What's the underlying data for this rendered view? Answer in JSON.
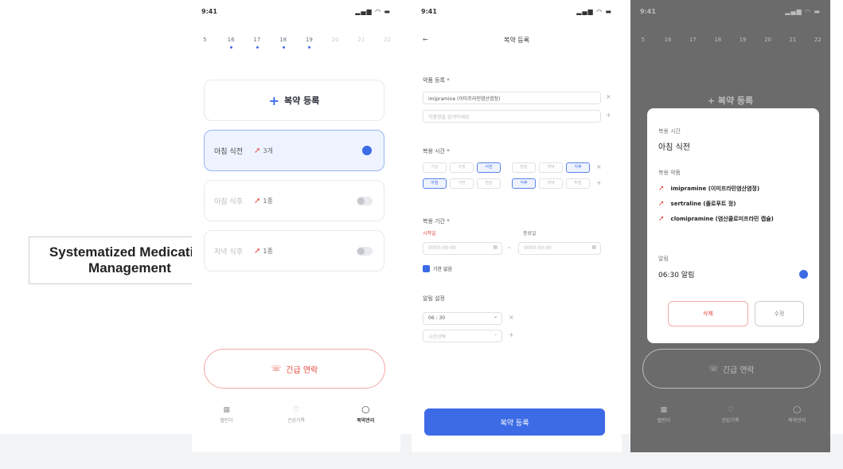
{
  "caption": "Systematized Medication Management",
  "colors": {
    "accent": "#3d6be6",
    "danger": "#e2473b",
    "overlay": "#6b6b6b"
  },
  "screen1": {
    "status_time": "9:41",
    "status_icons": "signal-wifi-battery",
    "dates": [
      "5",
      "16",
      "17",
      "18",
      "19",
      "20",
      "21",
      "22"
    ],
    "add_label": "복약 등록",
    "meds": [
      {
        "name": "아침 식전",
        "count": "3개",
        "toggle": "on"
      },
      {
        "name": "아침 식후",
        "count": "1종",
        "toggle": "off"
      },
      {
        "name": "저녁 식후",
        "count": "1종",
        "toggle": "off"
      }
    ],
    "emergency_label": "긴급 연락",
    "tabs": [
      "캘린더",
      "건강기록",
      "복약관리"
    ]
  },
  "screen2": {
    "status_time": "9:41",
    "title": "복약 등록",
    "drug_label": "약품 등록 *",
    "drug_value": "imipramine (이미프라민염산염정)",
    "drug_placeholder": "약품명을 검색하세요",
    "time_label": "복용 시간 *",
    "time_chips_row1": [
      "기상",
      "아침",
      "식전",
      "점심",
      "저녁",
      "식후"
    ],
    "time_chips_row2": [
      "아침",
      "식전",
      "점심",
      "식후",
      "저녁",
      "취침"
    ],
    "period_label": "복용 기간 *",
    "start_label": "시작일",
    "end_label": "종료일",
    "date_placeholder": "0000-00-00",
    "no_end_label": "기한 없음",
    "alarm_label": "알림 설정",
    "alarm_value": "06 : 30",
    "alarm_placeholder": "시간선택",
    "submit_label": "복약 등록"
  },
  "screen3": {
    "status_time": "9:41",
    "dates": [
      "5",
      "16",
      "17",
      "18",
      "19",
      "20",
      "21",
      "22"
    ],
    "add_label": "복약 등록",
    "modal": {
      "time_label": "복용 시간",
      "time_value": "아침 식전",
      "meds_label": "복용 약품",
      "meds": [
        "imipramine (이미프라민염산염정)",
        "sertraline (졸로푸트 정)",
        "clomipramine (염산클로미프라민 캡슐)"
      ],
      "alarm_label": "알림",
      "alarm_value": "06:30 알림",
      "delete_label": "삭제",
      "edit_label": "수정"
    },
    "emergency_label": "긴급 연락",
    "tabs": [
      "캘린더",
      "건강기록",
      "복약관리"
    ]
  }
}
